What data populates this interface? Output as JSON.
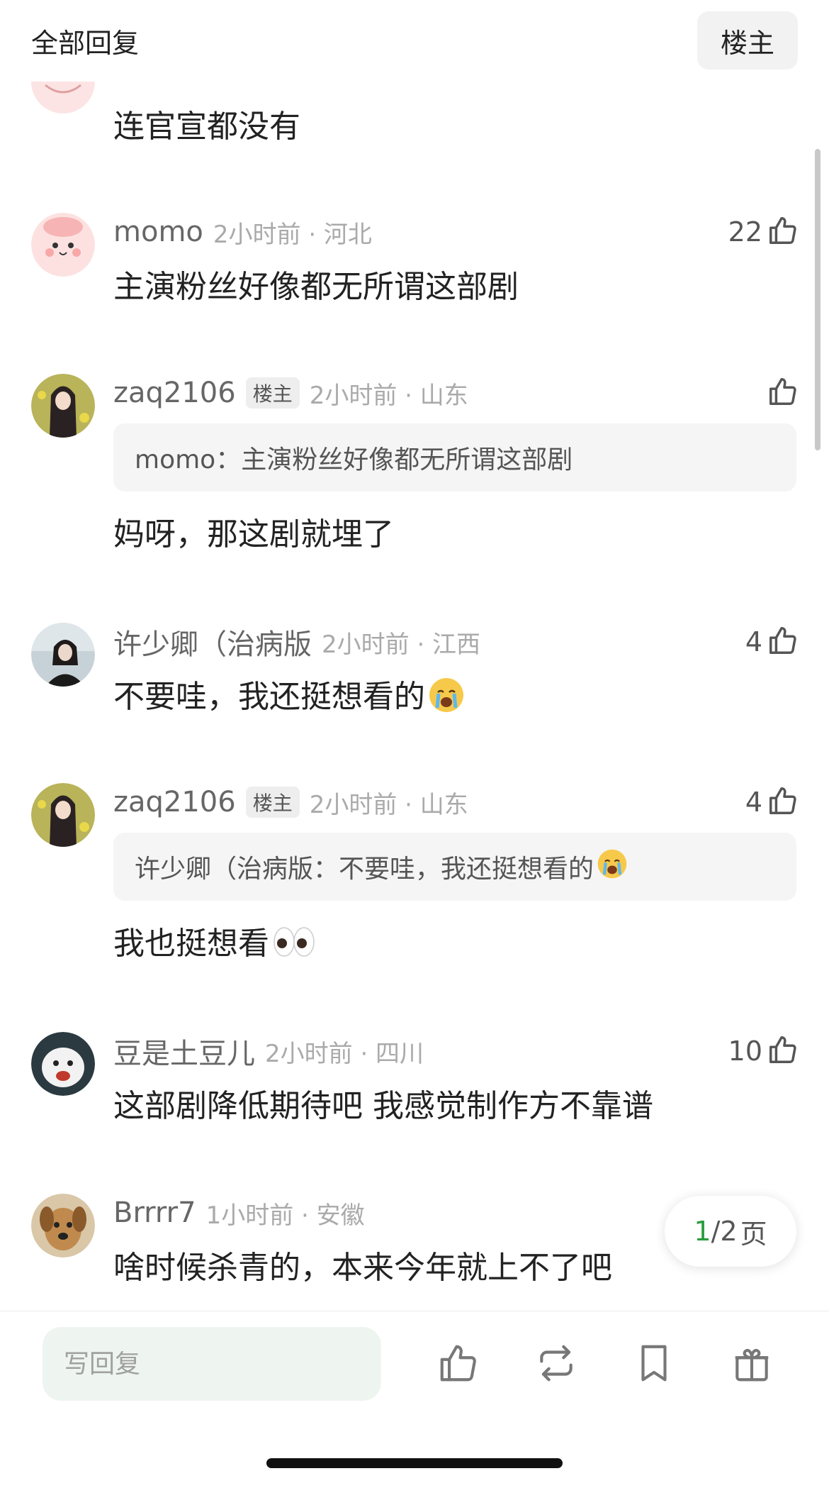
{
  "header": {
    "title": "全部回复",
    "owner_button": "楼主"
  },
  "comments": [
    {
      "text": "连官宣都没有"
    },
    {
      "username": "momo",
      "time_location": "2小时前 · 河北",
      "likes": "22",
      "text": "主演粉丝好像都无所谓这部剧"
    },
    {
      "username": "zaq2106",
      "badge": "楼主",
      "time_location": "2小时前 · 山东",
      "likes": "",
      "quote": "momo：主演粉丝好像都无所谓这部剧",
      "text": "妈呀，那这剧就埋了"
    },
    {
      "username": "许少卿（治病版",
      "time_location": "2小时前 · 江西",
      "likes": "4",
      "text": "不要哇，我还挺想看的"
    },
    {
      "username": "zaq2106",
      "badge": "楼主",
      "time_location": "2小时前 · 山东",
      "likes": "4",
      "quote": "许少卿（治病版：不要哇，我还挺想看的",
      "text": "我也挺想看"
    },
    {
      "username": "豆是土豆儿",
      "time_location": "2小时前 · 四川",
      "likes": "10",
      "text": "这部剧降低期待吧 我感觉制作方不靠谱"
    },
    {
      "username": "Brrrr7",
      "time_location": "1小时前 · 安徽",
      "likes": "",
      "text": "啥时候杀青的，本来今年就上不了吧"
    }
  ],
  "pager": {
    "current": "1",
    "total": "/2",
    "suffix": "页"
  },
  "bottom_bar": {
    "reply_placeholder": "写回复",
    "icons": [
      "thumbs-up-icon",
      "repost-icon",
      "bookmark-icon",
      "gift-icon"
    ]
  },
  "colors": {
    "accent": "#2a9d3c",
    "input_bg": "#eef5f0"
  }
}
